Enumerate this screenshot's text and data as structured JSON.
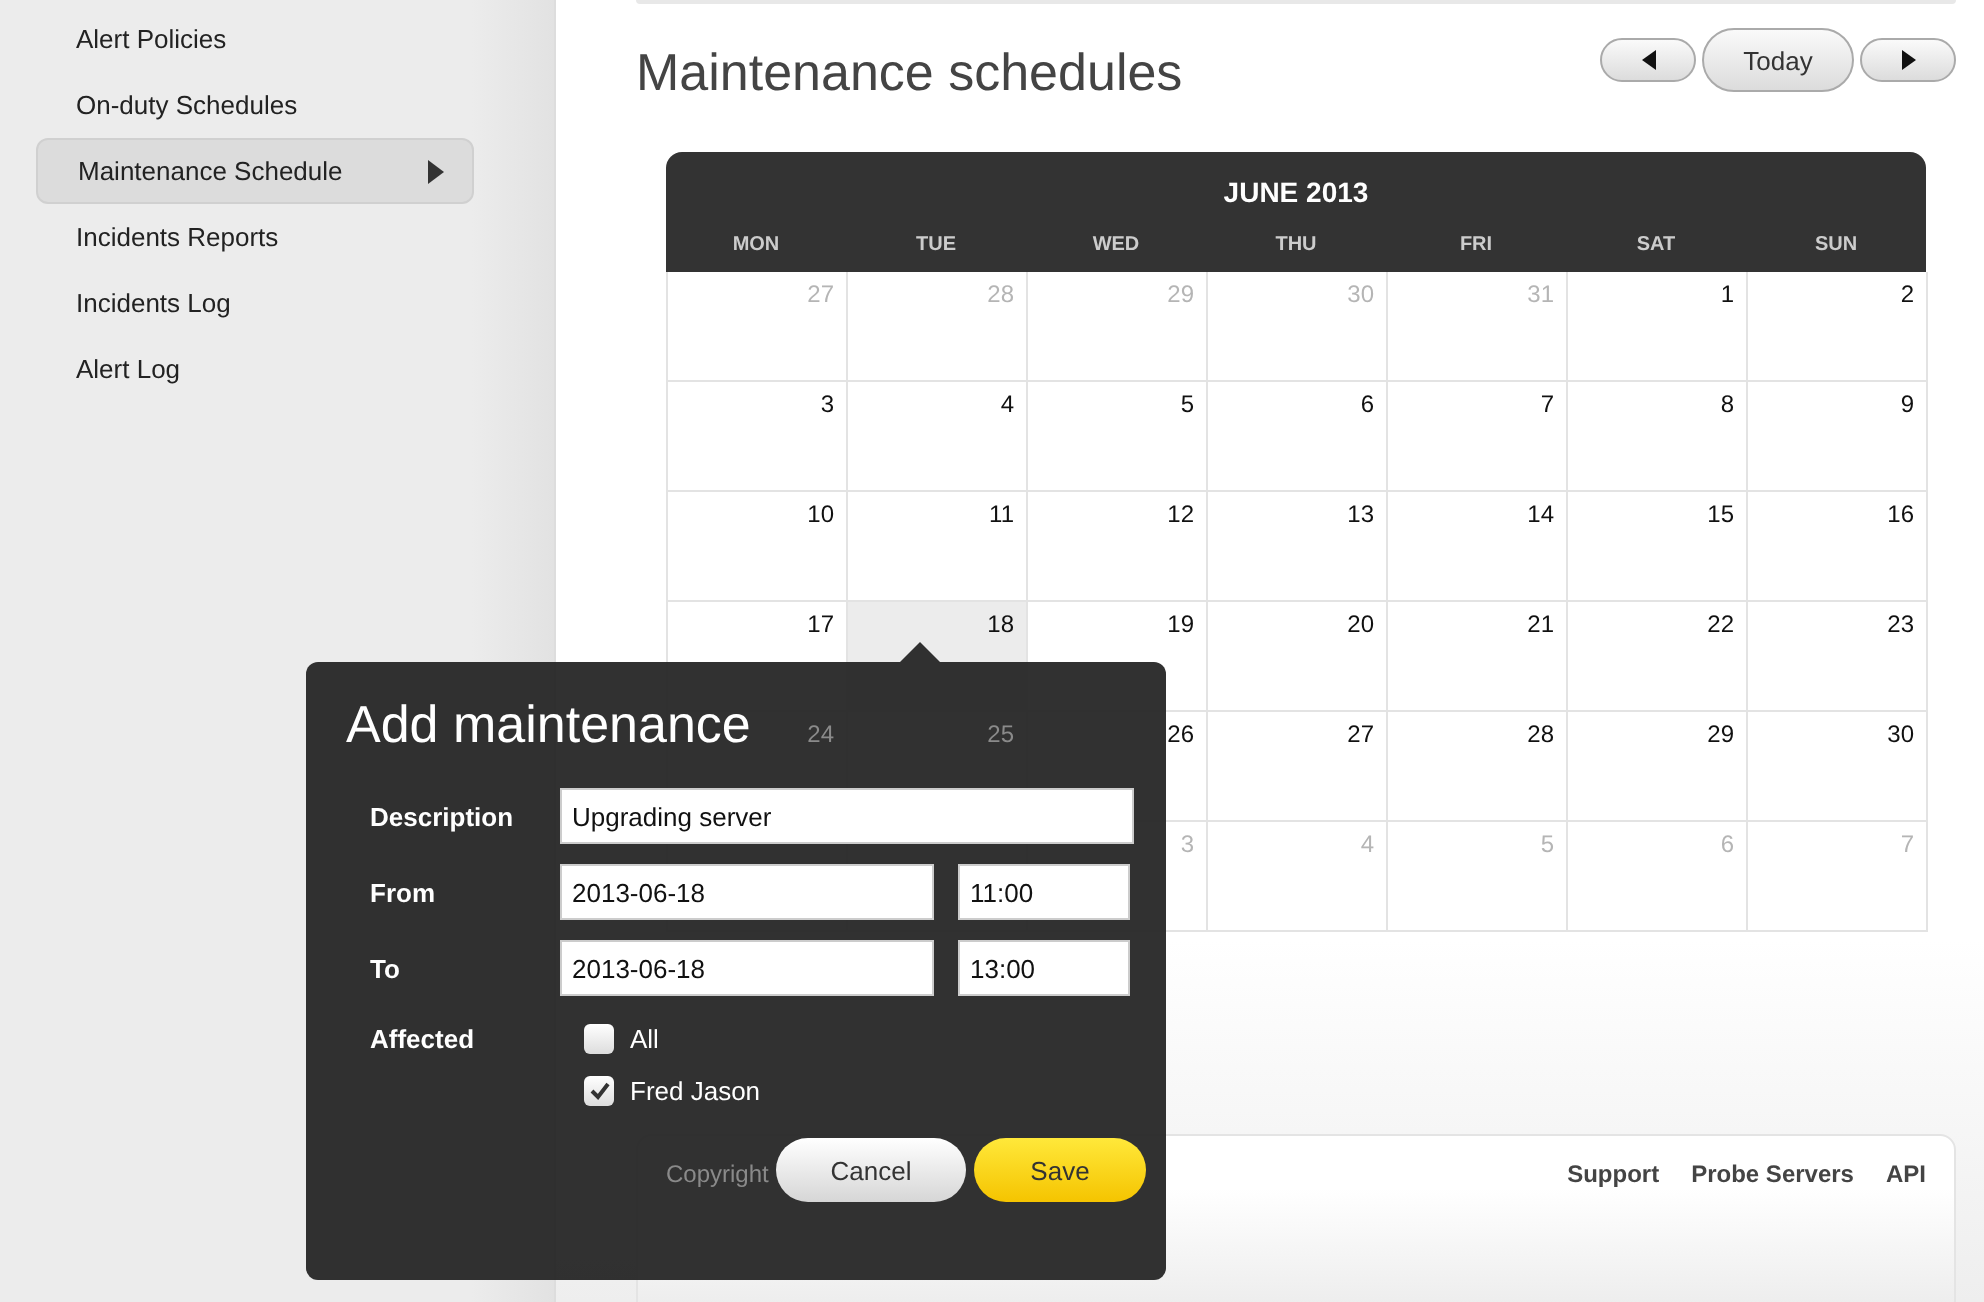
{
  "sidebar": {
    "items": [
      {
        "label": "Alert Policies",
        "selected": false
      },
      {
        "label": "On-duty Schedules",
        "selected": false
      },
      {
        "label": "Maintenance Schedule",
        "selected": true
      },
      {
        "label": "Incidents Reports",
        "selected": false
      },
      {
        "label": "Incidents Log",
        "selected": false
      },
      {
        "label": "Alert Log",
        "selected": false
      }
    ]
  },
  "page": {
    "title": "Maintenance schedules",
    "today_button": "Today"
  },
  "calendar": {
    "month": "JUNE 2013",
    "weekdays": [
      "MON",
      "TUE",
      "WED",
      "THU",
      "FRI",
      "SAT",
      "SUN"
    ],
    "weeks": [
      [
        {
          "day": "27",
          "outside": true,
          "selected": false
        },
        {
          "day": "28",
          "outside": true,
          "selected": false
        },
        {
          "day": "29",
          "outside": true,
          "selected": false
        },
        {
          "day": "30",
          "outside": true,
          "selected": false
        },
        {
          "day": "31",
          "outside": true,
          "selected": false
        },
        {
          "day": "1",
          "outside": false,
          "selected": false
        },
        {
          "day": "2",
          "outside": false,
          "selected": false
        }
      ],
      [
        {
          "day": "3",
          "outside": false,
          "selected": false
        },
        {
          "day": "4",
          "outside": false,
          "selected": false
        },
        {
          "day": "5",
          "outside": false,
          "selected": false
        },
        {
          "day": "6",
          "outside": false,
          "selected": false
        },
        {
          "day": "7",
          "outside": false,
          "selected": false
        },
        {
          "day": "8",
          "outside": false,
          "selected": false
        },
        {
          "day": "9",
          "outside": false,
          "selected": false
        }
      ],
      [
        {
          "day": "10",
          "outside": false,
          "selected": false
        },
        {
          "day": "11",
          "outside": false,
          "selected": false
        },
        {
          "day": "12",
          "outside": false,
          "selected": false
        },
        {
          "day": "13",
          "outside": false,
          "selected": false
        },
        {
          "day": "14",
          "outside": false,
          "selected": false
        },
        {
          "day": "15",
          "outside": false,
          "selected": false
        },
        {
          "day": "16",
          "outside": false,
          "selected": false
        }
      ],
      [
        {
          "day": "17",
          "outside": false,
          "selected": false
        },
        {
          "day": "18",
          "outside": false,
          "selected": true
        },
        {
          "day": "19",
          "outside": false,
          "selected": false
        },
        {
          "day": "20",
          "outside": false,
          "selected": false
        },
        {
          "day": "21",
          "outside": false,
          "selected": false
        },
        {
          "day": "22",
          "outside": false,
          "selected": false
        },
        {
          "day": "23",
          "outside": false,
          "selected": false
        }
      ],
      [
        {
          "day": "24"
        },
        {
          "day": "25"
        },
        {
          "day": "26",
          "outside": false,
          "selected": false
        },
        {
          "day": "27",
          "outside": false,
          "selected": false
        },
        {
          "day": "28",
          "outside": false,
          "selected": false
        },
        {
          "day": "29",
          "outside": false,
          "selected": false
        },
        {
          "day": "30",
          "outside": false,
          "selected": false
        }
      ],
      [
        {
          "day": "3",
          "outside": true,
          "selected": false
        },
        {
          "day": "4",
          "outside": true,
          "selected": false
        },
        {
          "day": "5",
          "outside": true,
          "selected": false
        },
        {
          "day": "6",
          "outside": true,
          "selected": false
        },
        {
          "day": "7",
          "outside": true,
          "selected": false
        }
      ]
    ]
  },
  "popup": {
    "title": "Add maintenance",
    "fields": [
      {
        "label": "Description",
        "kind": "text",
        "value": "Upgrading server"
      },
      {
        "label": "From",
        "kind": "datetime",
        "date": "2013-06-18",
        "time": "11:00"
      },
      {
        "label": "To",
        "kind": "datetime",
        "date": "2013-06-18",
        "time": "13:00"
      }
    ],
    "affected": {
      "label": "Affected",
      "options": [
        {
          "label": "All",
          "checked": false
        },
        {
          "label": "Fred Jason",
          "checked": true
        }
      ]
    },
    "buttons": [
      {
        "label": "Cancel",
        "kind": "secondary"
      },
      {
        "label": "Save",
        "kind": "primary"
      }
    ]
  },
  "footer": {
    "copyright": "Copyright",
    "links": [
      "Support",
      "Probe Servers",
      "API"
    ]
  }
}
